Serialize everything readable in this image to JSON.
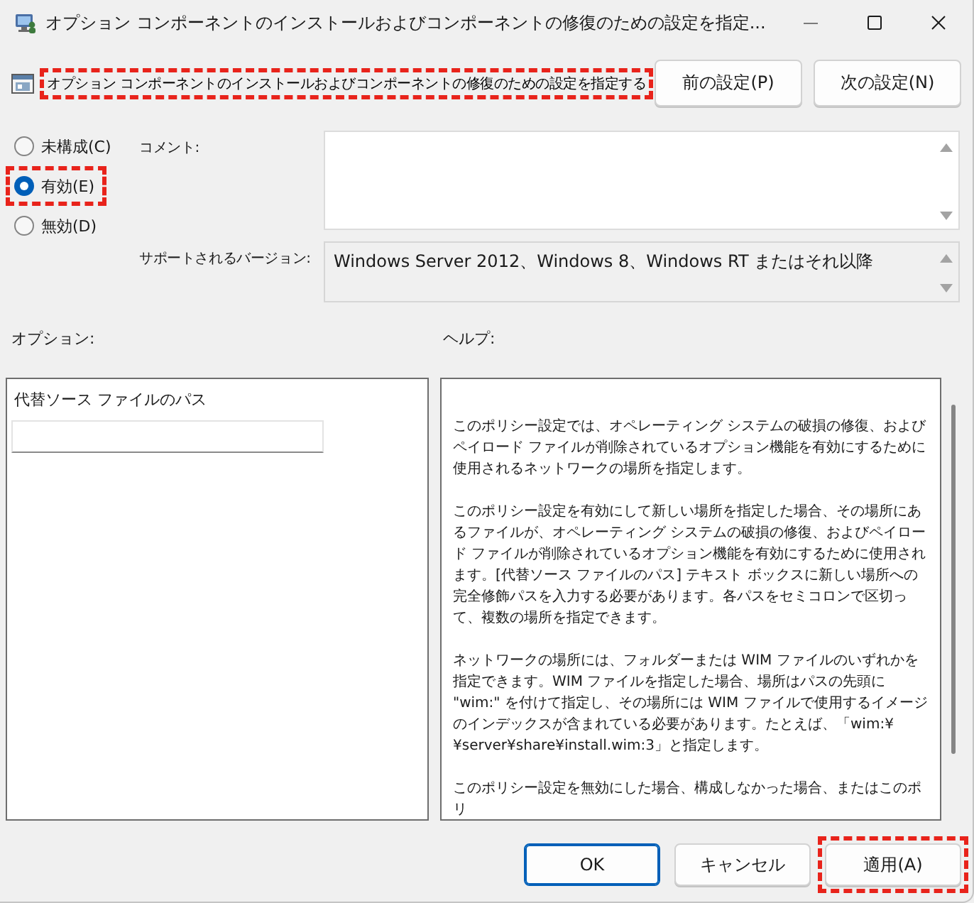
{
  "window": {
    "title": "オプション コンポーネントのインストールおよびコンポーネントの修復のための設定を指定..."
  },
  "header": {
    "heading": "オプション  コンポーネントのインストールおよびコンポーネントの修復のための設定を指定する",
    "highlighted": true
  },
  "nav_buttons": [
    {
      "label": "前の設定(P)"
    },
    {
      "label": "次の設定(N)"
    }
  ],
  "state_options": [
    {
      "label": "未構成(C)",
      "selected": false,
      "highlighted": false
    },
    {
      "label": "有効(E)",
      "selected": true,
      "highlighted": true
    },
    {
      "label": "無効(D)",
      "selected": false,
      "highlighted": false
    }
  ],
  "comment": {
    "label": "コメント:"
  },
  "supported_on": {
    "label": "サポートされるバージョン:",
    "value": "Windows Server 2012、Windows 8、Windows RT またはそれ以降"
  },
  "options": {
    "label": "オプション:",
    "fields": [
      {
        "label": "代替ソース ファイルのパス"
      }
    ]
  },
  "help": {
    "label": "ヘルプ:",
    "paragraphs": [
      "このポリシー設定では、オペレーティング システムの破損の修復、およびペイロード ファイルが削除されているオプション機能を有効にするために使用されるネットワークの場所を指定します。",
      "このポリシー設定を有効にして新しい場所を指定した場合、その場所にあるファイルが、オペレーティング システムの破損の修復、およびペイロード ファイルが削除されているオプション機能を有効にするために使用されます。[代替ソース ファイルのパス] テキスト ボックスに新しい場所への完全修飾パスを入力する必要があります。各パスをセミコロンで区切って、複数の場所を指定できます。",
      "ネットワークの場所には、フォルダーまたは WIM ファイルのいずれかを指定できます。WIM ファイルを指定した場合、場所はパスの先頭に \"wim:\" を付けて指定し、その場所には WIM ファイルで使用するイメージのインデックスが含まれている必要があります。たとえば、「wim:¥¥server¥share¥install.wim:3」と指定します。",
      "このポリシー設定を無効にした場合、構成しなかった場合、またはこのポリ"
    ]
  },
  "buttons": [
    {
      "label": "OK",
      "default": true,
      "highlighted": false
    },
    {
      "label": "キャンセル",
      "default": false,
      "highlighted": false
    },
    {
      "label": "適用(A)",
      "default": false,
      "highlighted": true
    }
  ]
}
